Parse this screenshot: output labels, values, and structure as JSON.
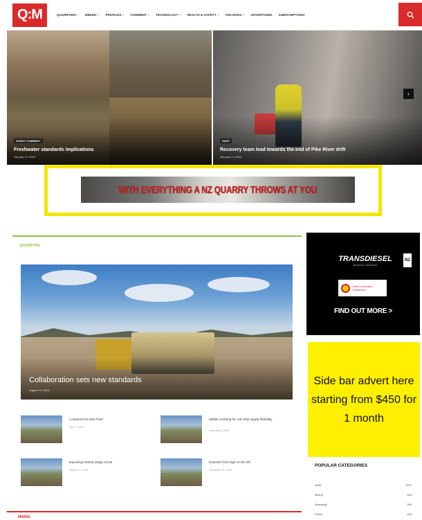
{
  "header": {
    "logo": "Q:M",
    "nav": [
      "QUARRYING ~",
      "MINING ~",
      "PROFILES ~",
      "COMMENT ~",
      "TECHNOLOGY ~",
      "HEALTH & SAFETY ~",
      "ARCHIVES ~",
      "ADVERTISING",
      "SUBSCRIPTIONS"
    ],
    "search_icon": "search-icon"
  },
  "hero": {
    "left": {
      "tag": "GUEST COMMENT",
      "title": "Freshwater standards implications",
      "date": "January 13, 2024"
    },
    "right": {
      "tag": "SAFE",
      "title": "Recovery team lead towards the end of Pike River drift",
      "date": "January 13, 2024"
    },
    "arrow": "›"
  },
  "banner": {
    "text": "WITH EVERYTHING A NZ QUARRY THROWS AT YOU"
  },
  "main": {
    "section_label": "QUARRYING",
    "feature": {
      "title": "Collaboration sets new standards",
      "date": "August 13, 2024"
    },
    "news": [
      {
        "title": "A reprieve for Kiwi Point",
        "date": "April 3, 2024"
      },
      {
        "title": "Mobile crushing for cost ship supply flexibility",
        "date": "February 6, 2024"
      },
      {
        "title": "Exporting Central Otago schist",
        "date": "January 4, 2024"
      },
      {
        "title": "Dolomite from high on the hill",
        "date": "December 20, 2023"
      }
    ],
    "bottom_label": "MINING"
  },
  "sidebar": {
    "ad_black": {
      "brand": "TRANSDIESEL",
      "sub": "WE'VE GOT YOUR BACK",
      "nz": "NZ",
      "shell_line1": "Shell Lubricants",
      "shell_line2": "Distributor",
      "cta": "FIND OUT MORE >"
    },
    "ad_yellow": "Side bar advert here starting from $450 for 1 month",
    "popular": {
      "title": "POPULAR CATEGORIES",
      "rows": [
        {
          "label": "Q&M",
          "count": "1102"
        },
        {
          "label": "Mining",
          "count": "444"
        },
        {
          "label": "Quarrying",
          "count": "390"
        },
        {
          "label": "Profile",
          "count": "203"
        }
      ]
    }
  },
  "colors": {
    "brand_red": "#d92b2b",
    "quarrying_green": "#8cc63f",
    "highlight_yellow": "#f4e600"
  }
}
